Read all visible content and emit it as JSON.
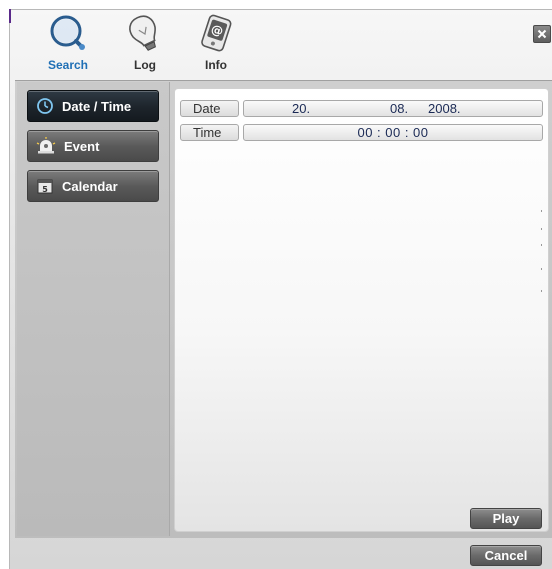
{
  "toolbar": {
    "tabs": [
      {
        "label": "Search",
        "icon": "search-icon",
        "active": true
      },
      {
        "label": "Log",
        "icon": "lightbulb-icon",
        "active": false
      },
      {
        "label": "Info",
        "icon": "info-device-icon",
        "active": false
      }
    ],
    "close_icon": "close-icon"
  },
  "sidebar": {
    "items": [
      {
        "label": "Date / Time",
        "icon": "clock-icon",
        "active": true
      },
      {
        "label": "Event",
        "icon": "alarm-icon",
        "active": false
      },
      {
        "label": "Calendar",
        "icon": "calendar-icon",
        "active": false
      }
    ]
  },
  "form": {
    "date": {
      "label": "Date",
      "day": "20.",
      "month": "08.",
      "year": "2008."
    },
    "time": {
      "label": "Time",
      "value": "00 : 00 : 00"
    }
  },
  "actions": {
    "play": "Play",
    "cancel": "Cancel"
  },
  "colors": {
    "active_tab": "#1f6fb5",
    "value_text": "#1b2a55",
    "active_sidebar": "#1d242b"
  }
}
